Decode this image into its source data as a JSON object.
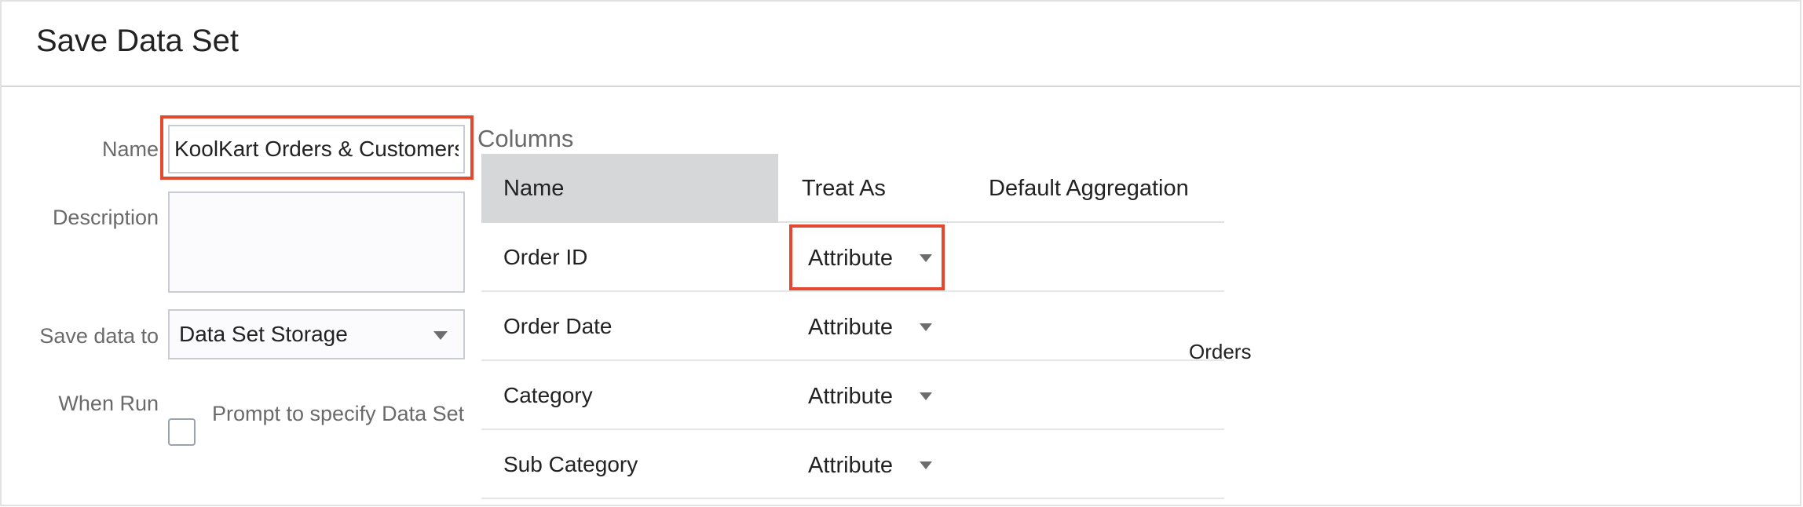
{
  "dialog": {
    "title": "Save Data Set"
  },
  "form": {
    "name_label": "Name",
    "name_value": "KoolKart Orders & Customers",
    "description_label": "Description",
    "description_value": "",
    "save_to_label": "Save data to",
    "save_to_value": "Data Set Storage",
    "when_run_label": "When Run",
    "prompt_checkbox_label": "Prompt to specify Data Set",
    "prompt_checked": false
  },
  "columns": {
    "title": "Columns",
    "headers": [
      "Name",
      "Treat As",
      "Default Aggregation"
    ],
    "rows": [
      {
        "name": "Order ID",
        "treat_as": "Attribute",
        "aggregation": ""
      },
      {
        "name": "Order Date",
        "treat_as": "Attribute",
        "aggregation": ""
      },
      {
        "name": "Category",
        "treat_as": "Attribute",
        "aggregation": ""
      },
      {
        "name": "Sub Category",
        "treat_as": "Attribute",
        "aggregation": ""
      }
    ]
  },
  "floating_label": "Orders",
  "icons": {
    "dropdown": "chevron-down-icon"
  },
  "colors": {
    "highlight": "#e3492f",
    "header_bg": "#d6d7d8"
  }
}
